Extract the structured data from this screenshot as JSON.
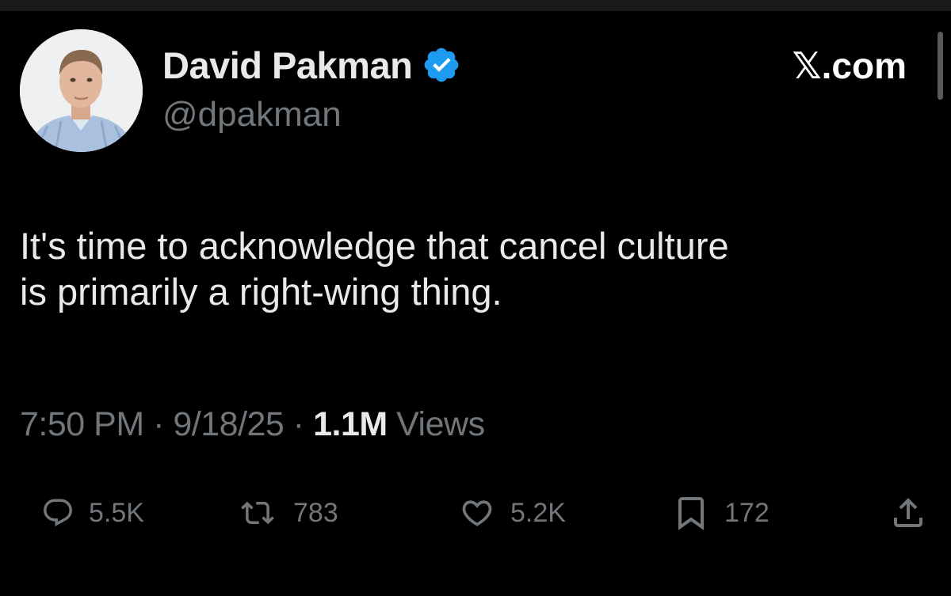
{
  "profile": {
    "display_name": "David Pakman",
    "handle": "@dpakman",
    "verified": true,
    "verified_color": "#1d9bf0"
  },
  "source": "𝕏.com",
  "tweet": {
    "text_lines": [
      "It's time to acknowledge that cancel culture",
      "is primarily a right-wing thing."
    ]
  },
  "meta": {
    "time": "7:50 PM",
    "separator": "·",
    "date": "9/18/25",
    "views_count": "1.1M",
    "views_label": "Views"
  },
  "actions": {
    "replies": {
      "icon": "reply-icon",
      "count": "5.5K"
    },
    "reposts": {
      "icon": "repost-icon",
      "count": "783"
    },
    "likes": {
      "icon": "heart-icon",
      "count": "5.2K"
    },
    "bookmarks": {
      "icon": "bookmark-icon",
      "count": "172"
    },
    "share": {
      "icon": "share-icon"
    }
  },
  "colors": {
    "background": "#000000",
    "primary_text": "#e7e9ea",
    "secondary_text": "#71767b"
  }
}
